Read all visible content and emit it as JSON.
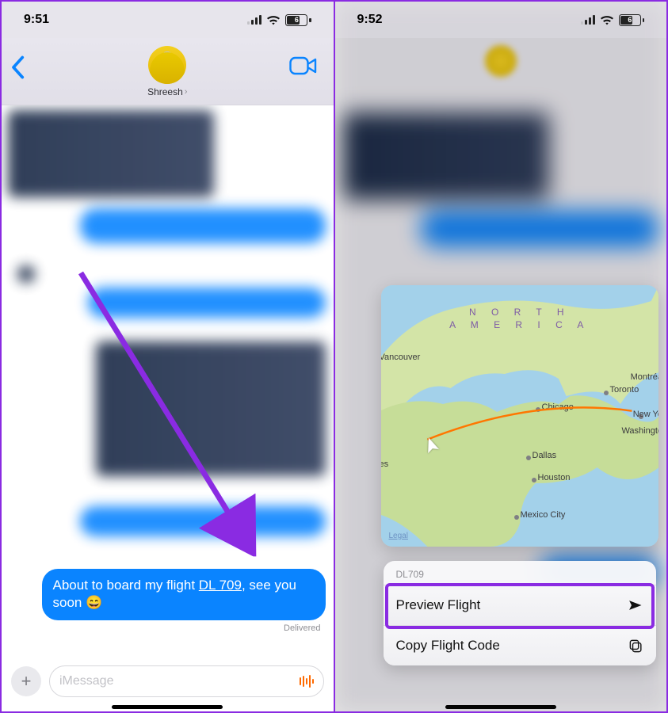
{
  "left": {
    "time": "9:51",
    "battery_level": "6",
    "contact_name": "Shreesh",
    "message_text_prefix": "About to board my flight ",
    "message_flight_link": "DL 709",
    "message_text_suffix": ", see you soon 😄",
    "delivered_label": "Delivered",
    "composer_placeholder": "iMessage"
  },
  "right": {
    "time": "9:52",
    "battery_level": "6",
    "map": {
      "title_line1": "N O R T H",
      "title_line2": "A M E R I C A",
      "legal": "Legal",
      "cities": {
        "vancouver": "Vancouver",
        "chicago": "Chicago",
        "toronto": "Toronto",
        "montreal": "Montréa",
        "new_york": "New Yo",
        "washington": "Washingto",
        "dallas": "Dallas",
        "houston": "Houston",
        "mexico": "Mexico City",
        "es_tail": "es"
      }
    },
    "menu": {
      "code": "DL709",
      "preview": "Preview Flight",
      "copy": "Copy Flight Code"
    }
  }
}
